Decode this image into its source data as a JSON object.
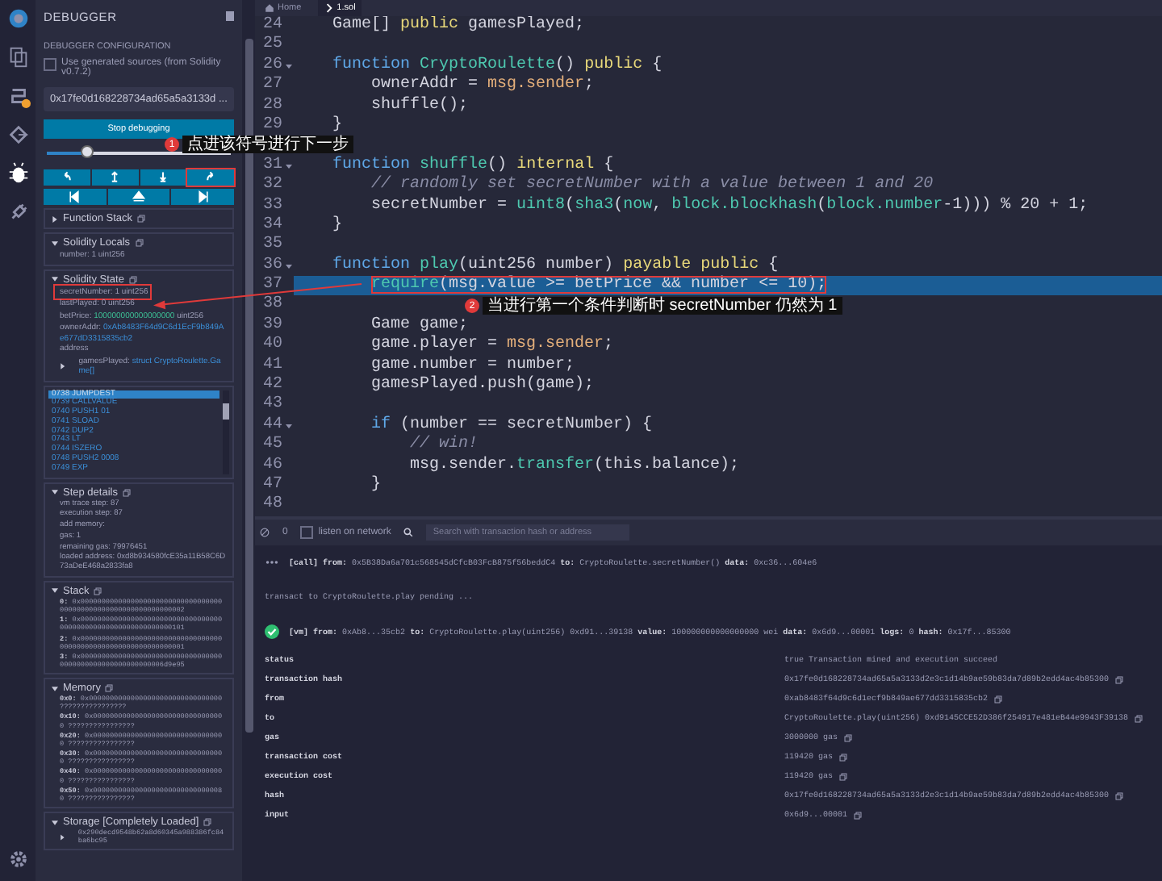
{
  "activity_bar": [
    {
      "kind": "logo",
      "selected": false,
      "badge": false
    },
    {
      "kind": "files",
      "selected": false,
      "badge": false
    },
    {
      "kind": "compiler",
      "selected": false,
      "badge": true
    },
    {
      "kind": "deploy",
      "selected": false,
      "badge": false
    },
    {
      "kind": "debugger",
      "selected": true,
      "badge": false
    },
    {
      "kind": "plugins",
      "selected": false,
      "badge": false
    },
    {
      "kind": "settings",
      "selected": false,
      "badge": false
    }
  ],
  "debugger": {
    "title": "DEBUGGER",
    "config_heading": "DEBUGGER CONFIGURATION",
    "generated_sources": {
      "label": "Use generated sources (from Solidity v0.7.2)",
      "checked": false
    },
    "tx_hash": "0x17fe0d168228734ad65a5a3133d ...",
    "stop_button": "Stop debugging",
    "slider": {
      "level": 0.22
    },
    "step_buttons": [
      {
        "kind": "step-over-back",
        "marked": false
      },
      {
        "kind": "step-back",
        "marked": false
      },
      {
        "kind": "step-into",
        "marked": false
      },
      {
        "kind": "step-over-forward",
        "marked": true
      }
    ],
    "jump_buttons": [
      {
        "kind": "jump-previous"
      },
      {
        "kind": "jump-out"
      },
      {
        "kind": "jump-next"
      }
    ],
    "function_stack": {
      "title": "Function Stack",
      "expanded": false
    },
    "solidity_locals": {
      "title": "Solidity Locals",
      "expanded": true,
      "items": [
        {
          "kind": "plain",
          "name": "number:",
          "value": "1",
          "type": "uint256",
          "marked": false
        }
      ]
    },
    "solidity_state": {
      "title": "Solidity State",
      "expanded": true,
      "items": [
        {
          "kind": "plain",
          "name": "secretNumber:",
          "value": "1",
          "type": "uint256",
          "marked": true
        },
        {
          "kind": "plain",
          "name": "lastPlayed:",
          "value": "0",
          "type": "uint256",
          "marked": false
        },
        {
          "kind": "number",
          "name": "betPrice:",
          "value": "100000000000000000",
          "type": "uint256",
          "marked": false
        },
        {
          "kind": "address",
          "name": "ownerAddr:",
          "value": "0xAb8483F64d9C6d1EcF9b849Ae677dD3315835cb2",
          "type": "address",
          "marked": false
        },
        {
          "kind": "struct",
          "name": "gamesPlayed:",
          "value": "struct CryptoRoulette.Game[]",
          "marked": false
        }
      ]
    },
    "opcodes": [
      {
        "text": "0738 JUMPDEST",
        "selected": true
      },
      {
        "text": "0739 CALLVALUE",
        "selected": false
      },
      {
        "text": "0740 PUSH1 01",
        "selected": false
      },
      {
        "text": "0741 SLOAD",
        "selected": false
      },
      {
        "text": "0742 DUP2",
        "selected": false
      },
      {
        "text": "0743 LT",
        "selected": false
      },
      {
        "text": "0744 ISZERO",
        "selected": false
      },
      {
        "text": "0748 PUSH2 0008",
        "selected": false
      },
      {
        "text": "0749 EXP",
        "selected": false
      }
    ],
    "step_details": {
      "title": "Step details",
      "expanded": true,
      "lines": [
        "vm trace step: 87",
        "execution step: 87",
        "add memory:",
        "gas: 1",
        "remaining gas: 79976451",
        "loaded address: 0xd8b934580fcE35a11B58C6D73aDeE468a2833fa8"
      ]
    },
    "stack": {
      "title": "Stack",
      "expanded": true,
      "items": [
        {
          "key": "0:",
          "value": "0x0000000000000000000000000000000000000000000000000000000000000002"
        },
        {
          "key": "1:",
          "value": "0x0000000000000000000000000000000000000000000000000000000000000101"
        },
        {
          "key": "2:",
          "value": "0x0000000000000000000000000000000000000000000000000000000000000001"
        },
        {
          "key": "3:",
          "value": "0x00000000000000000000000000000000000000000000000000000000006d9e95"
        }
      ]
    },
    "memory": {
      "title": "Memory",
      "expanded": true,
      "items": [
        {
          "key": "0x0:",
          "value": "0x00000000000000000000000000000000 ????????????????"
        },
        {
          "key": "0x10:",
          "value": "0x00000000000000000000000000000000 ????????????????"
        },
        {
          "key": "0x20:",
          "value": "0x00000000000000000000000000000000 ????????????????"
        },
        {
          "key": "0x30:",
          "value": "0x00000000000000000000000000000000 ????????????????"
        },
        {
          "key": "0x40:",
          "value": "0x00000000000000000000000000000000 ????????????????"
        },
        {
          "key": "0x50:",
          "value": "0x00000000000000000000000000000080 ????????????????"
        }
      ]
    },
    "storage": {
      "title": "Storage [Completely Loaded]",
      "expanded": true,
      "items": [
        {
          "text": "0x290decd9548b62a8d60345a988386fc84ba6bc95",
          "expanded": false
        }
      ]
    }
  },
  "editor": {
    "tabs": [
      {
        "label": "Home",
        "kind": "home",
        "selected": false
      },
      {
        "label": "1.sol",
        "kind": "file",
        "selected": true
      }
    ],
    "lines": [
      {
        "number": "24",
        "foldable": false,
        "selected": false,
        "marked": false,
        "tokens": [
          {
            "text": "    Game[] ",
            "kind": "plain"
          },
          {
            "text": "public",
            "kind": "modifier"
          },
          {
            "text": " gamesPlayed;",
            "kind": "plain"
          }
        ]
      },
      {
        "number": "25",
        "foldable": false,
        "selected": false,
        "marked": false
      },
      {
        "number": "26",
        "foldable": true,
        "selected": false,
        "marked": false,
        "tokens": [
          {
            "text": "    function ",
            "kind": "keyword"
          },
          {
            "text": "CryptoRoulette",
            "kind": "ident"
          },
          {
            "text": "() ",
            "kind": "plain"
          },
          {
            "text": "public",
            "kind": "modifier"
          },
          {
            "text": " {",
            "kind": "plain"
          }
        ]
      },
      {
        "number": "27",
        "foldable": false,
        "selected": false,
        "marked": false,
        "tokens": [
          {
            "text": "        ownerAddr = ",
            "kind": "plain"
          },
          {
            "text": "msg.sender",
            "kind": "global"
          },
          {
            "text": ";",
            "kind": "plain"
          }
        ]
      },
      {
        "number": "28",
        "foldable": false,
        "selected": false,
        "marked": false,
        "tokens": [
          {
            "text": "        shuffle();",
            "kind": "plain"
          }
        ]
      },
      {
        "number": "29",
        "foldable": false,
        "selected": false,
        "marked": false,
        "tokens": [
          {
            "text": "    }",
            "kind": "plain"
          }
        ]
      },
      {
        "selected": false,
        "marked": false
      },
      {
        "number": "31",
        "foldable": true,
        "selected": false,
        "marked": false,
        "tokens": [
          {
            "text": "    function ",
            "kind": "keyword"
          },
          {
            "text": "shuffle",
            "kind": "ident"
          },
          {
            "text": "() ",
            "kind": "plain"
          },
          {
            "text": "internal",
            "kind": "modifier"
          },
          {
            "text": " {",
            "kind": "plain"
          }
        ]
      },
      {
        "number": "32",
        "foldable": false,
        "selected": false,
        "marked": false,
        "tokens": [
          {
            "text": "        // randomly set secretNumber with a value between 1 and 20",
            "kind": "comment"
          }
        ]
      },
      {
        "number": "33",
        "foldable": false,
        "selected": false,
        "marked": false,
        "tokens": [
          {
            "text": "        secretNumber = ",
            "kind": "plain"
          },
          {
            "text": "uint8",
            "kind": "ident"
          },
          {
            "text": "(",
            "kind": "plain"
          },
          {
            "text": "sha3",
            "kind": "ident"
          },
          {
            "text": "(",
            "kind": "plain"
          },
          {
            "text": "now",
            "kind": "ident"
          },
          {
            "text": ", ",
            "kind": "plain"
          },
          {
            "text": "block.blockhash",
            "kind": "ident"
          },
          {
            "text": "(",
            "kind": "plain"
          },
          {
            "text": "block.number",
            "kind": "ident"
          },
          {
            "text": "-1))) % 20 + 1;",
            "kind": "plain"
          }
        ]
      },
      {
        "number": "34",
        "foldable": false,
        "selected": false,
        "marked": false,
        "tokens": [
          {
            "text": "    }",
            "kind": "plain"
          }
        ]
      },
      {
        "number": "35",
        "foldable": false,
        "selected": false,
        "marked": false
      },
      {
        "number": "36",
        "foldable": true,
        "selected": false,
        "marked": false,
        "tokens": [
          {
            "text": "    function ",
            "kind": "keyword"
          },
          {
            "text": "play",
            "kind": "ident"
          },
          {
            "text": "(uint256 number) ",
            "kind": "plain"
          },
          {
            "text": "payable public",
            "kind": "modifier"
          },
          {
            "text": " {",
            "kind": "plain"
          }
        ]
      },
      {
        "number": "37",
        "foldable": false,
        "selected": true,
        "marked": true,
        "tokens": [
          {
            "text": "        require",
            "kind": "ident"
          },
          {
            "text": "(msg.value >= betPrice && number <= 10);",
            "kind": "plain"
          }
        ]
      },
      {
        "number": "38",
        "foldable": false,
        "selected": false,
        "marked": false
      },
      {
        "number": "39",
        "foldable": false,
        "selected": false,
        "marked": false,
        "tokens": [
          {
            "text": "        Game game;",
            "kind": "plain"
          }
        ]
      },
      {
        "number": "40",
        "foldable": false,
        "selected": false,
        "marked": false,
        "tokens": [
          {
            "text": "        game.player = ",
            "kind": "plain"
          },
          {
            "text": "msg.sender",
            "kind": "global"
          },
          {
            "text": ";",
            "kind": "plain"
          }
        ]
      },
      {
        "number": "41",
        "foldable": false,
        "selected": false,
        "marked": false,
        "tokens": [
          {
            "text": "        game.number = number;",
            "kind": "plain"
          }
        ]
      },
      {
        "number": "42",
        "foldable": false,
        "selected": false,
        "marked": false,
        "tokens": [
          {
            "text": "        gamesPlayed.push(game);",
            "kind": "plain"
          }
        ]
      },
      {
        "number": "43",
        "foldable": false,
        "selected": false,
        "marked": false
      },
      {
        "number": "44",
        "foldable": true,
        "selected": false,
        "marked": false,
        "tokens": [
          {
            "text": "        if",
            "kind": "keyword"
          },
          {
            "text": " (number == secretNumber) {",
            "kind": "plain"
          }
        ]
      },
      {
        "number": "45",
        "foldable": false,
        "selected": false,
        "marked": false,
        "tokens": [
          {
            "text": "            // win!",
            "kind": "comment"
          }
        ]
      },
      {
        "number": "46",
        "foldable": false,
        "selected": false,
        "marked": false,
        "tokens": [
          {
            "text": "            msg.sender.",
            "kind": "plain"
          },
          {
            "text": "transfer",
            "kind": "ident"
          },
          {
            "text": "(this.balance);",
            "kind": "plain"
          }
        ]
      },
      {
        "number": "47",
        "foldable": false,
        "selected": false,
        "marked": false,
        "tokens": [
          {
            "text": "        }",
            "kind": "plain"
          }
        ]
      },
      {
        "number": "48",
        "foldable": false,
        "selected": false,
        "marked": false
      }
    ]
  },
  "terminal": {
    "pending_count": "0",
    "listen_on_network": {
      "label": "listen on network",
      "checked": false
    },
    "search": {
      "placeholder": "Search with transaction hash or address"
    },
    "logs": [
      {
        "kind": "call",
        "text": "**[call]** **from:** 0x5B38Da6a701c568545dCfcB03FcB875f56beddC4 **to:** CryptoRoulette.secretNumber() **data:** 0xc36...604e6"
      },
      {
        "kind": "info",
        "text": "transact to CryptoRoulette.play pending ..."
      },
      {
        "kind": "tx",
        "text": "**[vm]** **from:** 0xAb8...35cb2 **to:** CryptoRoulette.play(uint256) 0xd91...39138 **value:** 100000000000000000 wei **data:** 0x6d9...00001 **logs:** 0 **hash:** 0x17f...85300"
      }
    ],
    "details": [
      {
        "key": "status",
        "value": "true Transaction mined and execution succeed",
        "copyable": false
      },
      {
        "key": "transaction hash",
        "value": "0x17fe0d168228734ad65a5a3133d2e3c1d14b9ae59b83da7d89b2edd4ac4b85300",
        "copyable": true
      },
      {
        "key": "from",
        "value": "0xab8483f64d9c6d1ecf9b849ae677dd3315835cb2",
        "copyable": true
      },
      {
        "key": "to",
        "value": "CryptoRoulette.play(uint256) 0xd9145CCE52D386f254917e481eB44e9943F39138",
        "copyable": true
      },
      {
        "key": "gas",
        "value": "3000000 gas",
        "copyable": true
      },
      {
        "key": "transaction cost",
        "value": "119420 gas",
        "copyable": true
      },
      {
        "key": "execution cost",
        "value": "119420 gas",
        "copyable": true
      },
      {
        "key": "hash",
        "value": "0x17fe0d168228734ad65a5a3133d2e3c1d14b9ae59b83da7d89b2edd4ac4b85300",
        "copyable": true
      },
      {
        "key": "input",
        "value": "0x6d9...00001",
        "copyable": true
      }
    ]
  },
  "annotations": [
    {
      "number": "1",
      "text": "点进该符号进行下一步"
    },
    {
      "number": "2",
      "text": "当进行第一个条件判断时 secretNumber 仍然为 1"
    }
  ]
}
